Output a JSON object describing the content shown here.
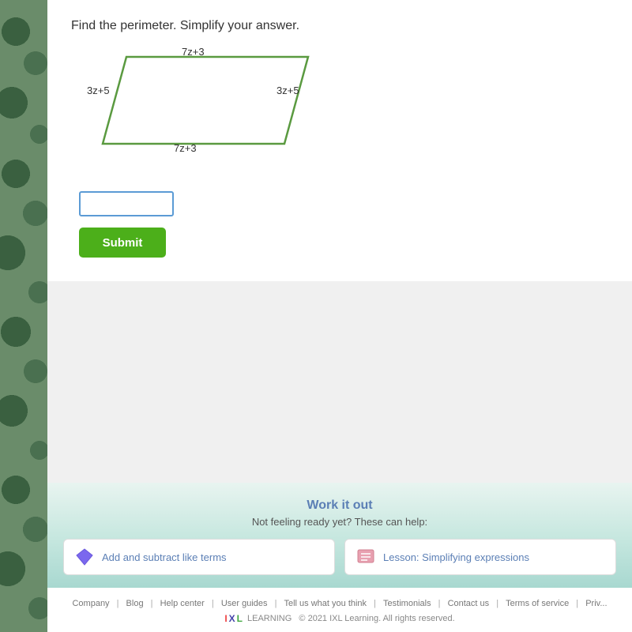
{
  "question": {
    "instruction": "Find the perimeter. Simplify your answer.",
    "shape": {
      "top_label": "7z+3",
      "bottom_label": "7z+3",
      "left_label": "3z+5",
      "right_label": "3z+5"
    }
  },
  "answer": {
    "input_placeholder": "",
    "submit_label": "Submit"
  },
  "work_it_out": {
    "title": "Work it out",
    "subtitle": "Not feeling ready yet? These can help:",
    "links": [
      {
        "label": "Add and subtract like terms",
        "icon": "diamond-icon"
      },
      {
        "label": "Lesson: Simplifying expressions",
        "icon": "lesson-icon"
      }
    ]
  },
  "footer": {
    "links": [
      "Company",
      "Blog",
      "Help center",
      "User guides",
      "Tell us what you think",
      "Testimonials",
      "Contact us",
      "Terms of service",
      "Priv"
    ],
    "copyright": "© 2021 IXL Learning. All rights reserved.",
    "brand": "IXL LEARNING"
  }
}
